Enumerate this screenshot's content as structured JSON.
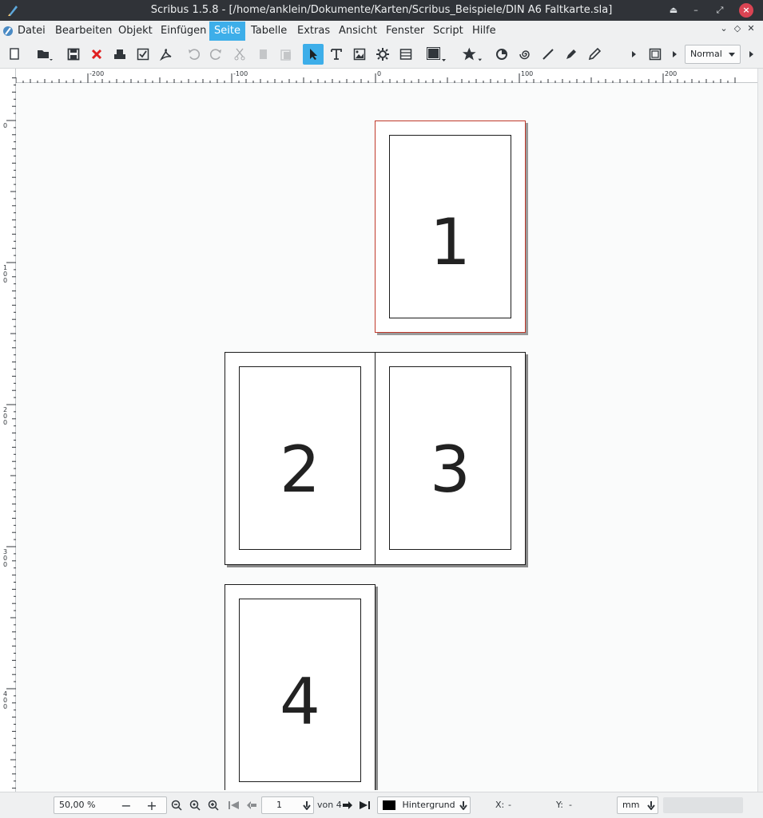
{
  "window": {
    "title": "Scribus 1.5.8 - [/home/anklein/Dokumente/Karten/Scribus_Beispiele/DIN A6 Faltkarte.sla]"
  },
  "menu": {
    "items": [
      "Datei",
      "Bearbeiten",
      "Objekt",
      "Einfügen",
      "Seite",
      "Tabelle",
      "Extras",
      "Ansicht",
      "Fenster",
      "Script",
      "Hilfe"
    ],
    "active": "Seite"
  },
  "toolbar": {
    "mode_select": "Normal"
  },
  "rulers": {
    "horizontal_labels": [
      "-200",
      "-100",
      "0",
      "100",
      "200"
    ],
    "vertical_labels": [
      "0",
      "100",
      "200",
      "300",
      "400"
    ]
  },
  "pages": [
    {
      "number": "1",
      "current": true
    },
    {
      "number": "2",
      "current": false
    },
    {
      "number": "3",
      "current": false
    },
    {
      "number": "4",
      "current": false
    }
  ],
  "status": {
    "zoom": "50,00 %",
    "page_input": "1",
    "page_of": "von 4",
    "layer": "Hintergrund",
    "x_label": "X:",
    "x_value": "-",
    "y_label": "Y:",
    "y_value": "-",
    "unit": "mm"
  },
  "colors": {
    "accent": "#3daee9",
    "current_page_border": "#c0392b",
    "close_button": "#da4453",
    "titlebar": "#303338"
  }
}
